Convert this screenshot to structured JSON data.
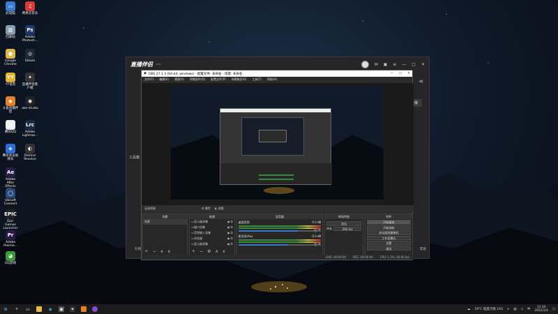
{
  "desktop_icons": [
    {
      "label": "此电脑",
      "color": "#3a7bd5",
      "glyph": "▭",
      "icon": "computer-icon"
    },
    {
      "label": "网易云音乐",
      "color": "#d53a3a",
      "glyph": "♫",
      "icon": "netease-music-icon"
    },
    {
      "label": "回收站",
      "color": "#8a9bb0",
      "glyph": "▥",
      "icon": "recycle-bin-icon"
    },
    {
      "label": "Adobe Photosh...",
      "color": "#1b3a6b",
      "glyph": "Ps",
      "icon": "photoshop-icon"
    },
    {
      "label": "Google Chrome",
      "color": "#e0b84a",
      "glyph": "●",
      "icon": "chrome-icon"
    },
    {
      "label": "Steam",
      "color": "#1b2838",
      "glyph": "◎",
      "icon": "steam-icon"
    },
    {
      "label": "YY语音",
      "color": "#e6b32a",
      "glyph": "YY",
      "icon": "yy-icon"
    },
    {
      "label": "直播伴侣客户端",
      "color": "#333",
      "glyph": "✦",
      "icon": "livestream-assistant-icon"
    },
    {
      "label": "斗鱼直播伴侣",
      "color": "#e8802a",
      "glyph": "◆",
      "icon": "douyu-icon"
    },
    {
      "label": "obs-studio",
      "color": "#222",
      "glyph": "◉",
      "icon": "obs-icon"
    },
    {
      "label": "腾讯QQ",
      "color": "#f0f0f0",
      "glyph": "◔",
      "icon": "qq-icon"
    },
    {
      "label": "Adobe Lightroo...",
      "color": "#1a2b45",
      "glyph": "Lrc",
      "icon": "lightroom-icon"
    },
    {
      "label": "腾讯会议视频号",
      "color": "#2a6fd5",
      "glyph": "◈",
      "icon": "tencent-meeting-icon"
    },
    {
      "label": "DaVinci Resolve",
      "color": "#333",
      "glyph": "◐",
      "icon": "davinci-icon"
    },
    {
      "label": "Adobe After Effects CC...",
      "color": "#2a1f4a",
      "glyph": "Ae",
      "icon": "after-effects-icon"
    },
    {
      "label": "Ubisoft Connect",
      "color": "#2a4a7a",
      "glyph": "◯",
      "icon": "ubisoft-icon"
    },
    {
      "label": "Epic Games Launcher",
      "color": "#222",
      "glyph": "EPIC",
      "icon": "epic-games-icon"
    },
    {
      "label": "Adobe Premie...",
      "color": "#2a1a4a",
      "glyph": "Pr",
      "icon": "premiere-icon"
    },
    {
      "label": "QQ游戏",
      "color": "#3a9a3a",
      "glyph": "◕",
      "icon": "qq-game-icon"
    }
  ],
  "zb_window": {
    "logo": "直播伴侣",
    "badge": "",
    "left_label": "工具箱",
    "right_button": "开始直播",
    "bottom_left": "礼物",
    "bottom_right": "帮助"
  },
  "obs": {
    "title": "OBS 27.1.3 (64-bit, windows) - 配置文件: 未命名 - 场景: 未命名",
    "menu": [
      "文件(F)",
      "编辑(E)",
      "视图(V)",
      "停靠部件(D)",
      "配置文件(P)",
      "场景集合(S)",
      "工具(T)",
      "帮助(H)"
    ],
    "toolbar_left": "无选择源",
    "toolbar_props": "属性",
    "toolbar_filters": "滤镜",
    "docks": {
      "scenes": {
        "title": "场景",
        "items": [
          "场景"
        ]
      },
      "sources": {
        "title": "来源",
        "items": [
          "显示器采集",
          "窗口采集",
          "音频输入采集",
          "浏览器",
          "显示器采集"
        ]
      },
      "mixer": {
        "title": "混音器",
        "tracks": [
          {
            "name": "桌面音频",
            "db": "0.0 dB",
            "level": 0.72
          },
          {
            "name": "麦克风/Aux",
            "db": "0.0 dB",
            "level": 0.6
          }
        ]
      },
      "transitions": {
        "title": "转场特效",
        "type": "淡出",
        "duration_label": "时长",
        "duration": "300 ms"
      },
      "controls": {
        "title": "控件",
        "buttons": [
          "开始推流",
          "开始录制",
          "启动虚拟摄像机",
          "工作室模式",
          "设置",
          "退出"
        ]
      }
    },
    "status": {
      "live": "LIVE: 00:00:00",
      "rec": "REC: 00:00:00",
      "cpu": "CPU: 1.5%, 60.00 fps"
    }
  },
  "taskbar": {
    "weather": "19°C 轻度污染 143",
    "time": "11:34",
    "date": "2022/1/4",
    "ime": "中"
  }
}
